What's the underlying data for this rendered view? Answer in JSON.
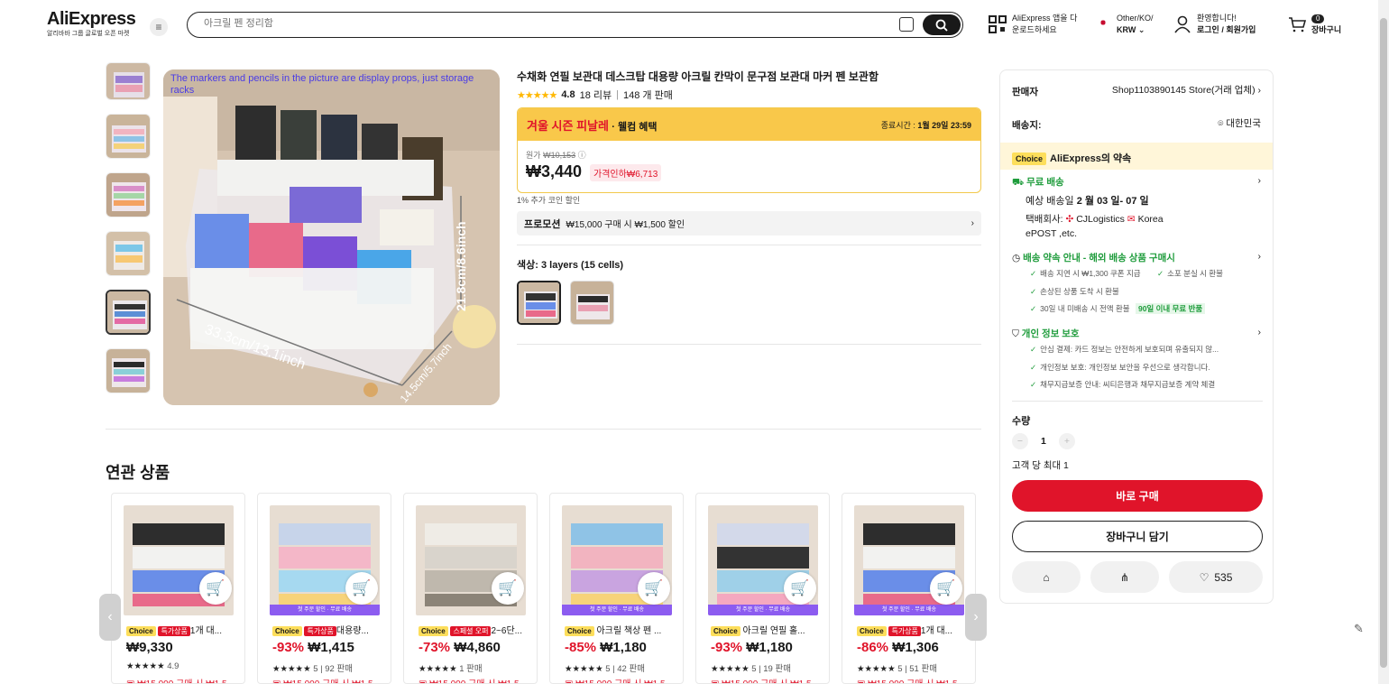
{
  "header": {
    "logo": "AliExpress",
    "logo_sub": "알리바바 그룹 글로벌 오픈 마켓",
    "search_placeholder": "아크릴 펜 정리함",
    "app_line1": "AliExpress 앱을 다",
    "app_line2": "운로드하세요",
    "region_line1": "Other/KO/",
    "region_line2": "KRW",
    "welcome": "환영합니다!",
    "login": "로그인 / 회원가입",
    "cart_count": "0",
    "cart_label": "장바구니"
  },
  "product": {
    "caption": "The markers and pencils in the picture are display props, just storage racks",
    "title": "수채화 연필 보관대 데스크탑 대용량 아크릴 칸막이 문구점 보관대 마커 펜 보관함",
    "rating": "4.8",
    "reviews": "18 리뷰",
    "sold": "148 개 판매",
    "dim_width": "33.3cm/13.1inch",
    "dim_height": "21.8cm/8.6inch",
    "dim_depth": "14.5cm/5.7inch"
  },
  "promo": {
    "title": "겨울 시즌 피날레",
    "subtitle": "· 웰컴 혜택",
    "end_label": "종료시간 :",
    "end_time": "1월 29일 23:59",
    "orig_label": "원가",
    "orig_price": "₩10,153",
    "price": "₩3,440",
    "discount": "가격인하₩6,713",
    "coin": "1% 추가 코인 할인",
    "promo_label": "프로모션",
    "promo_text": "₩15,000 구매 시 ₩1,500 할인",
    "color_label": "색상:",
    "color_value": "3 layers (15 cells)"
  },
  "sidebar": {
    "seller_label": "판매자",
    "seller": "Shop1103890145 Store(거래 업체)",
    "ship_label": "배송지:",
    "ship_to": "대한민국",
    "choice": "Choice",
    "choice_text": "AliExpress의 약속",
    "free_ship": "무료 배송",
    "eta_prefix": "예상 배송일",
    "eta": "2 월 03 일- 07 일",
    "carrier_label": "택배회사:",
    "carrier1": "CJLogistics",
    "carrier2": "Korea",
    "carrier3": "ePOST ,etc.",
    "guarantee": "배송 약속 안내 - 해외 배송 상품 구매시",
    "g1": "배송 지연 시 ₩1,300 쿠폰 지급",
    "g2": "소포 분실 시 환불",
    "g3": "손상된 상품 도착 시 환불",
    "g4": "30일 내 미배송 시 전액 환불",
    "g4_badge": "90일 이내 무료 반품",
    "privacy": "개인 정보 보호",
    "p1": "안심 결제: 카드 정보는 안전하게 보호되며 유출되지 않...",
    "p2": "개인정보 보호: 개인정보 보안을 우선으로 생각합니다.",
    "p3": "채무지급보증 안내: 씨티은행과 채무지급보증 계약 체결",
    "qty_label": "수량",
    "qty": "1",
    "qty_limit": "고객 당 최대 1",
    "buy": "바로 구매",
    "add_cart": "장바구니 담기",
    "likes": "535"
  },
  "related": {
    "title": "연관 상품",
    "cards": [
      {
        "choice": "Choice",
        "special": "특가상품",
        "name": "1개 대...",
        "pct": "",
        "price": "₩9,330",
        "reviews": "4.9",
        "coupon": "₩15,000 구매 시 ₩1,5",
        "banner": ""
      },
      {
        "choice": "Choice",
        "special": "특가상품",
        "name": "대용량...",
        "pct": "-93%",
        "price": "₩1,415",
        "reviews": "5 | 92 판매",
        "coupon": "₩15,000 구매 시 ₩1,5",
        "banner": "첫 주문 할인 · 무료 배송"
      },
      {
        "choice": "Choice",
        "special": "스페셜 오퍼",
        "name": "2~6단...",
        "pct": "-73%",
        "price": "₩4,860",
        "reviews": "1 판매",
        "coupon": "₩15,000 구매 시 ₩1,5",
        "banner": ""
      },
      {
        "choice": "Choice",
        "special": "",
        "name": "아크릴 책상 펜 ...",
        "pct": "-85%",
        "price": "₩1,180",
        "reviews": "5 | 42 판매",
        "coupon": "₩15,000 구매 시 ₩1,5",
        "banner": "첫 주문 할인 · 무료 배송"
      },
      {
        "choice": "Choice",
        "special": "",
        "name": "아크릴 연필 홀...",
        "pct": "-93%",
        "price": "₩1,180",
        "reviews": "5 | 19 판매",
        "coupon": "₩15,000 구매 시 ₩1,5",
        "banner": "첫 주문 할인 · 무료 배송"
      },
      {
        "choice": "Choice",
        "special": "특가상품",
        "name": "1개 대...",
        "pct": "-86%",
        "price": "₩1,306",
        "reviews": "5 | 51 판매",
        "coupon": "₩15,000 구매 시 ₩1,5",
        "banner": "첫 주문 할인 · 무료 배송"
      }
    ]
  }
}
